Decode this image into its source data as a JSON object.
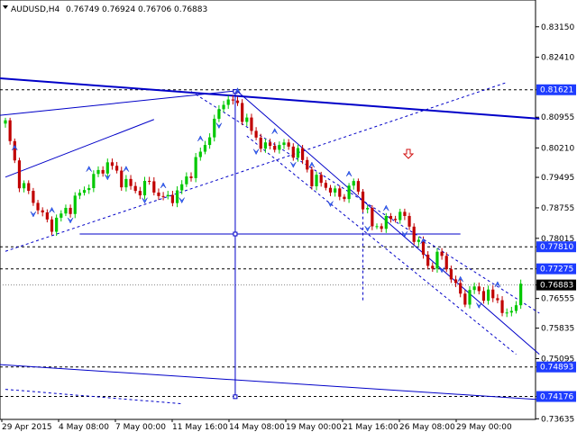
{
  "header": {
    "symbol": "AUDUSD,H4",
    "open": "0.76749",
    "high": "0.76924",
    "low": "0.76706",
    "close": "0.76883"
  },
  "colors": {
    "bull": "#00c800",
    "bear": "#c00000",
    "lines": "#0000c8",
    "label_bg": "#1e3cff",
    "arrow_down": "#d01010"
  },
  "icons": {
    "sell_signal": "red-down-arrow-icon"
  },
  "chart_data": {
    "type": "candlestick",
    "timeframe": "H4",
    "ylim": [
      0.7362,
      0.838
    ],
    "y_ticks": [
      "0.83150",
      "0.82410",
      "0.81621",
      "0.80955",
      "0.80210",
      "0.79495",
      "0.78755",
      "0.78015",
      "0.77810",
      "0.77275",
      "0.76883",
      "0.76555",
      "0.75835",
      "0.75095",
      "0.74893",
      "0.74176",
      "0.73635"
    ],
    "highlighted_levels": [
      {
        "value": "0.81621",
        "current": false
      },
      {
        "value": "0.77810",
        "current": false
      },
      {
        "value": "0.77275",
        "current": false
      },
      {
        "value": "0.76883",
        "current": true
      },
      {
        "value": "0.74893",
        "current": false
      },
      {
        "value": "0.74176",
        "current": false
      }
    ],
    "x_labels": [
      "29 Apr 2015",
      "4 May 08:00",
      "7 May 00:00",
      "11 May 16:00",
      "14 May 08:00",
      "19 May 00:00",
      "21 May 16:00",
      "26 May 08:00",
      "29 May 00:00"
    ],
    "close_path": [
      [
        0,
        0.808
      ],
      [
        3,
        0.794
      ],
      [
        6,
        0.7895
      ],
      [
        9,
        0.7838
      ],
      [
        10,
        0.7835
      ],
      [
        14,
        0.788
      ],
      [
        18,
        0.7935
      ],
      [
        22,
        0.7985
      ],
      [
        25,
        0.7945
      ],
      [
        28,
        0.7915
      ],
      [
        31,
        0.7935
      ],
      [
        34,
        0.7895
      ],
      [
        37,
        0.791
      ],
      [
        41,
        0.7985
      ],
      [
        45,
        0.808
      ],
      [
        47,
        0.814
      ],
      [
        50,
        0.8125
      ],
      [
        53,
        0.806
      ],
      [
        56,
        0.802
      ],
      [
        59,
        0.803
      ],
      [
        63,
        0.801
      ],
      [
        66,
        0.7945
      ],
      [
        69,
        0.793
      ],
      [
        72,
        0.79
      ],
      [
        75,
        0.7935
      ],
      [
        77,
        0.789
      ],
      [
        79,
        0.783
      ],
      [
        82,
        0.784
      ],
      [
        85,
        0.7865
      ],
      [
        88,
        0.781
      ],
      [
        91,
        0.7735
      ],
      [
        94,
        0.776
      ],
      [
        97,
        0.768
      ],
      [
        99,
        0.7655
      ],
      [
        101,
        0.768
      ],
      [
        104,
        0.766
      ],
      [
        106,
        0.7655
      ],
      [
        108,
        0.7605
      ],
      [
        110,
        0.765
      ],
      [
        111,
        0.7688
      ]
    ],
    "candle_count": 112
  }
}
